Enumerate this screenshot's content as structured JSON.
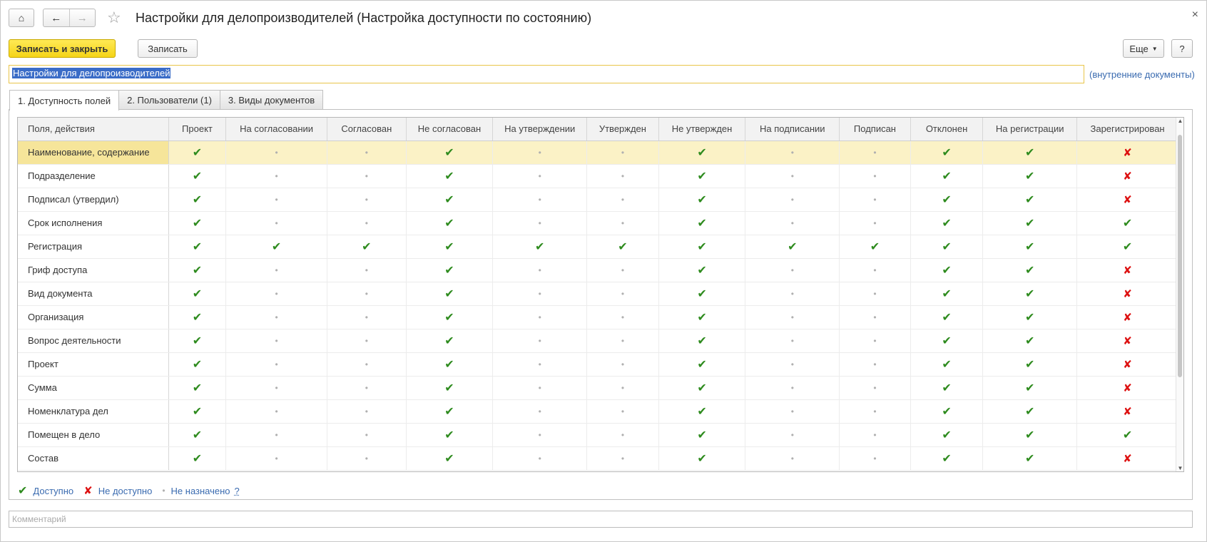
{
  "window": {
    "title": "Настройки для делопроизводителей (Настройка доступности по состоянию)",
    "close_glyph": "×"
  },
  "toolbar": {
    "save_close_label": "Записать и закрыть",
    "save_label": "Записать",
    "more_label": "Еще",
    "help_label": "?"
  },
  "name_field": {
    "value": "Настройки для делопроизводителей",
    "kind_link": "(внутренние документы)"
  },
  "tabs": [
    {
      "label": "1. Доступность полей",
      "active": true
    },
    {
      "label": "2. Пользователи (1)",
      "active": false
    },
    {
      "label": "3. Виды документов",
      "active": false
    }
  ],
  "grid": {
    "columns": [
      "Поля, действия",
      "Проект",
      "На согласовании",
      "Согласован",
      "Не согласован",
      "На утверждении",
      "Утвержден",
      "Не утвержден",
      "На подписании",
      "Подписан",
      "Отклонен",
      "На регистрации",
      "Зарегистрирован"
    ],
    "rows": [
      {
        "name": "Наименование, содержание",
        "selected": true,
        "states": [
          "ok",
          "na",
          "na",
          "ok",
          "na",
          "na",
          "ok",
          "na",
          "na",
          "ok",
          "ok",
          "no"
        ]
      },
      {
        "name": "Подразделение",
        "states": [
          "ok",
          "na",
          "na",
          "ok",
          "na",
          "na",
          "ok",
          "na",
          "na",
          "ok",
          "ok",
          "no"
        ]
      },
      {
        "name": "Подписал (утвердил)",
        "states": [
          "ok",
          "na",
          "na",
          "ok",
          "na",
          "na",
          "ok",
          "na",
          "na",
          "ok",
          "ok",
          "no"
        ]
      },
      {
        "name": "Срок исполнения",
        "states": [
          "ok",
          "na",
          "na",
          "ok",
          "na",
          "na",
          "ok",
          "na",
          "na",
          "ok",
          "ok",
          "ok"
        ]
      },
      {
        "name": "Регистрация",
        "states": [
          "ok",
          "ok",
          "ok",
          "ok",
          "ok",
          "ok",
          "ok",
          "ok",
          "ok",
          "ok",
          "ok",
          "ok"
        ]
      },
      {
        "name": "Гриф доступа",
        "states": [
          "ok",
          "na",
          "na",
          "ok",
          "na",
          "na",
          "ok",
          "na",
          "na",
          "ok",
          "ok",
          "no"
        ]
      },
      {
        "name": "Вид документа",
        "states": [
          "ok",
          "na",
          "na",
          "ok",
          "na",
          "na",
          "ok",
          "na",
          "na",
          "ok",
          "ok",
          "no"
        ]
      },
      {
        "name": "Организация",
        "states": [
          "ok",
          "na",
          "na",
          "ok",
          "na",
          "na",
          "ok",
          "na",
          "na",
          "ok",
          "ok",
          "no"
        ]
      },
      {
        "name": "Вопрос деятельности",
        "states": [
          "ok",
          "na",
          "na",
          "ok",
          "na",
          "na",
          "ok",
          "na",
          "na",
          "ok",
          "ok",
          "no"
        ]
      },
      {
        "name": "Проект",
        "states": [
          "ok",
          "na",
          "na",
          "ok",
          "na",
          "na",
          "ok",
          "na",
          "na",
          "ok",
          "ok",
          "no"
        ]
      },
      {
        "name": "Сумма",
        "states": [
          "ok",
          "na",
          "na",
          "ok",
          "na",
          "na",
          "ok",
          "na",
          "na",
          "ok",
          "ok",
          "no"
        ]
      },
      {
        "name": "Номенклатура дел",
        "states": [
          "ok",
          "na",
          "na",
          "ok",
          "na",
          "na",
          "ok",
          "na",
          "na",
          "ok",
          "ok",
          "no"
        ]
      },
      {
        "name": "Помещен в дело",
        "states": [
          "ok",
          "na",
          "na",
          "ok",
          "na",
          "na",
          "ok",
          "na",
          "na",
          "ok",
          "ok",
          "ok"
        ]
      },
      {
        "name": "Состав",
        "states": [
          "ok",
          "na",
          "na",
          "ok",
          "na",
          "na",
          "ok",
          "na",
          "na",
          "ok",
          "ok",
          "no"
        ]
      }
    ]
  },
  "icons": {
    "ok": "✔",
    "no": "✘",
    "na": "•"
  },
  "colors": {
    "ok": "#2e8b1e",
    "no": "#dd1111",
    "na": "#b0b0b0",
    "accent_yellow": "#f5d417",
    "link": "#3a6bb0",
    "selected_row": "#fbf2c6"
  },
  "legend": {
    "available": "Доступно",
    "unavailable": "Не доступно",
    "unassigned": "Не назначено",
    "help": "?"
  },
  "comment": {
    "placeholder": "Комментарий"
  }
}
